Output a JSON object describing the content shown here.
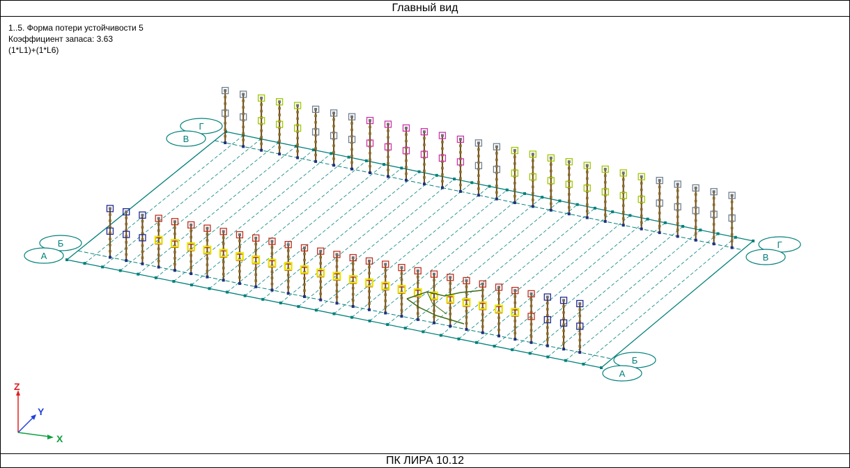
{
  "window": {
    "title": "Главный вид",
    "footer": "ПК ЛИРА 10.12"
  },
  "info": {
    "line1": "1..5. Форма потери устойчивости 5",
    "line2": "Коэффициент запаса: 3.63",
    "line3": "(1*L1)+(1*L6)"
  },
  "axes": {
    "z": "Z",
    "y": "Y",
    "x": "X"
  },
  "grid_bubbles": {
    "left_back_top": "Г",
    "left_back_bottom": "В",
    "left_front_top": "Б",
    "left_front_bottom": "А",
    "right_back_top": "Г",
    "right_back_bottom": "В",
    "right_front_top": "Б",
    "right_front_bottom": "А"
  },
  "colors": {
    "grid": "#00807a",
    "column": "#6b4a14",
    "marker_yellow": "#e8e800",
    "marker_magenta": "#cc33aa",
    "marker_red": "#c03020",
    "marker_blue": "#202890",
    "marker_gray": "#708090",
    "marker_lime": "#a0c800",
    "marker_cyan": "#80d0c0",
    "axis_z": "#e02020",
    "axis_y": "#2040e0",
    "axis_x": "#10a040"
  }
}
